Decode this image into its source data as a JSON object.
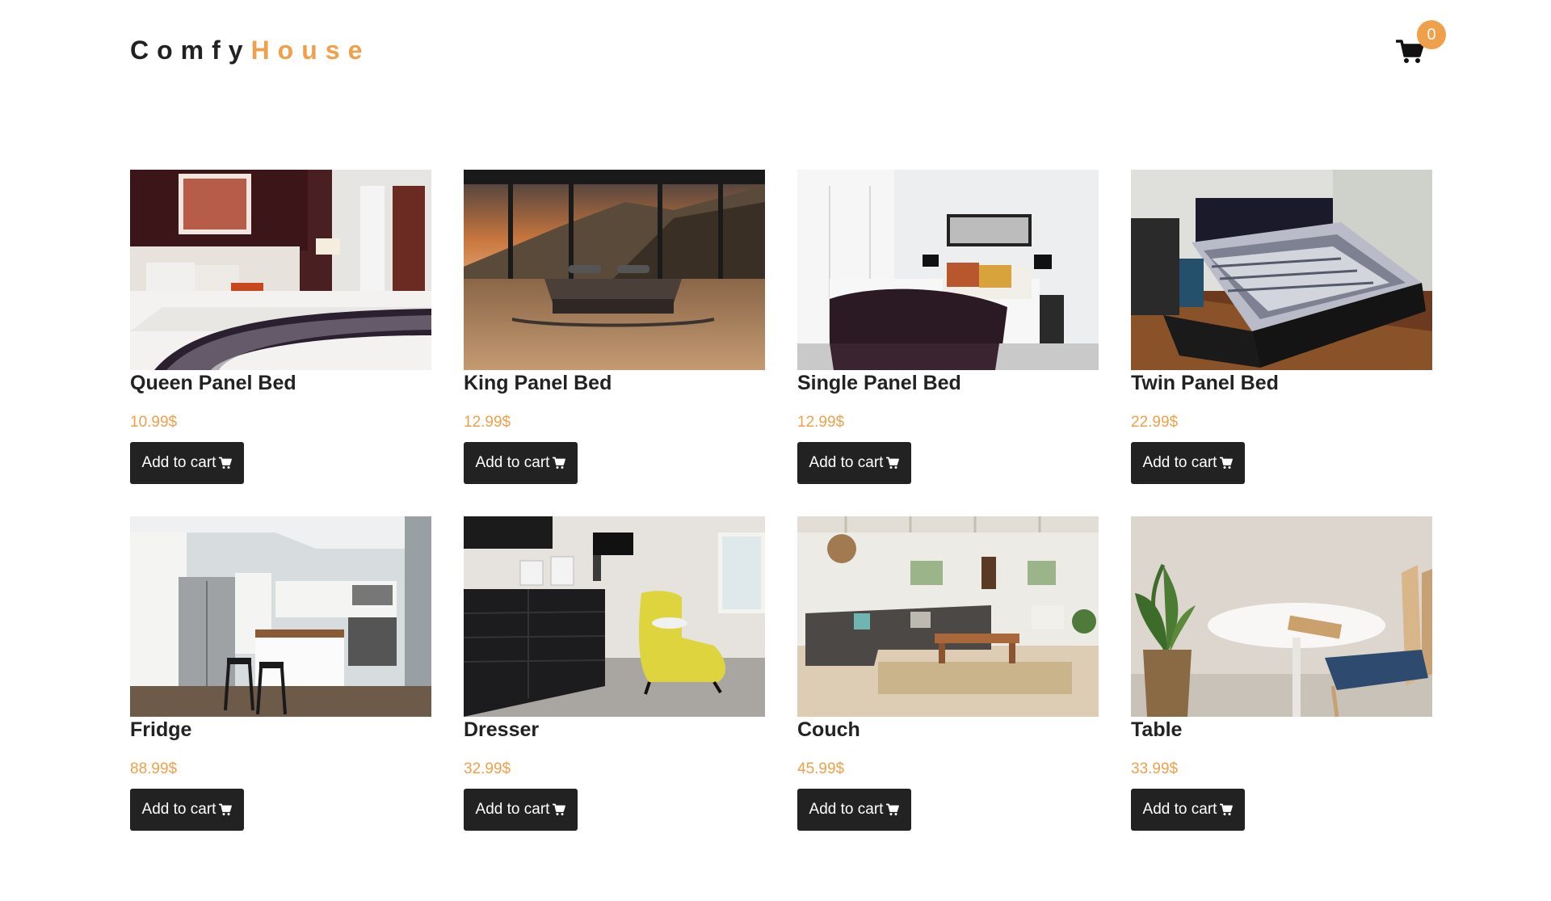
{
  "header": {
    "logo_part1": "Comfy",
    "logo_part2": "House",
    "cart_icon": "shopping-cart-icon",
    "cart_count": "0"
  },
  "colors": {
    "accent": "#f0a04b",
    "button_bg": "#222222",
    "text": "#222222"
  },
  "products": [
    {
      "title": "Queen Panel Bed",
      "price": "10.99$",
      "button_label": "Add to cart",
      "button_icon": "cart-icon"
    },
    {
      "title": "King Panel Bed",
      "price": "12.99$",
      "button_label": "Add to cart",
      "button_icon": "cart-icon"
    },
    {
      "title": "Single Panel Bed",
      "price": "12.99$",
      "button_label": "Add to cart",
      "button_icon": "cart-icon"
    },
    {
      "title": "Twin Panel Bed",
      "price": "22.99$",
      "button_label": "Add to cart",
      "button_icon": "cart-icon"
    },
    {
      "title": "Fridge",
      "price": "88.99$",
      "button_label": "Add to cart",
      "button_icon": "cart-icon"
    },
    {
      "title": "Dresser",
      "price": "32.99$",
      "button_label": "Add to cart",
      "button_icon": "cart-icon"
    },
    {
      "title": "Couch",
      "price": "45.99$",
      "button_label": "Add to cart",
      "button_icon": "cart-icon"
    },
    {
      "title": "Table",
      "price": "33.99$",
      "button_label": "Add to cart",
      "button_icon": "cart-icon"
    }
  ]
}
